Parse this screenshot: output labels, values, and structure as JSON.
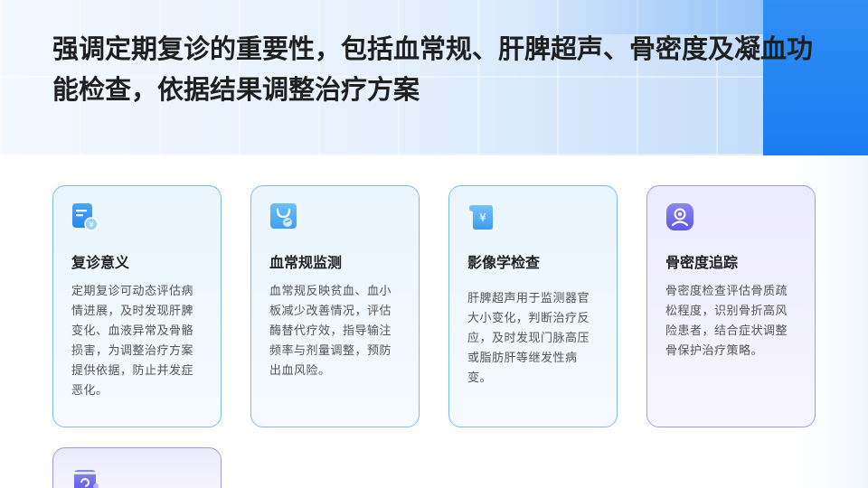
{
  "title": "强调定期复诊的重要性，包括血常规、肝脾超声、骨密度及凝血功能检查，依据结果调整治疗方案",
  "cards": [
    {
      "title": "复诊意义",
      "text": "定期复诊可动态评估病情进展，及时发现肝脾变化、血液异常及骨骼损害，为调整治疗方案提供依据，防止并发症恶化。",
      "icon": "document-yen-icon"
    },
    {
      "title": "血常规监测",
      "text": "血常规反映贫血、血小板减少改善情况，评估酶替代疗效，指导输注频率与剂量调整，预防出血风险。",
      "icon": "shopping-bag-icon"
    },
    {
      "title": "影像学检查",
      "text": "肝脾超声用于监测器官大小变化，判断治疗反应，及时发现门脉高压或脂肪肝等继发性病变。",
      "icon": "scroll-yen-icon"
    },
    {
      "title": "骨密度追踪",
      "text": "骨密度检查评估骨质疏松程度，识别骨折高风险患者，结合症状调整骨保护治疗策略。",
      "icon": "user-badge-icon"
    },
    {
      "title": "",
      "text": "",
      "icon": "bag-refresh-icon"
    }
  ],
  "colors": {
    "card_border_blue": "#7cbcec",
    "card_border_purple": "#9a9ee8",
    "accent_blue": "#1b7cf0"
  }
}
